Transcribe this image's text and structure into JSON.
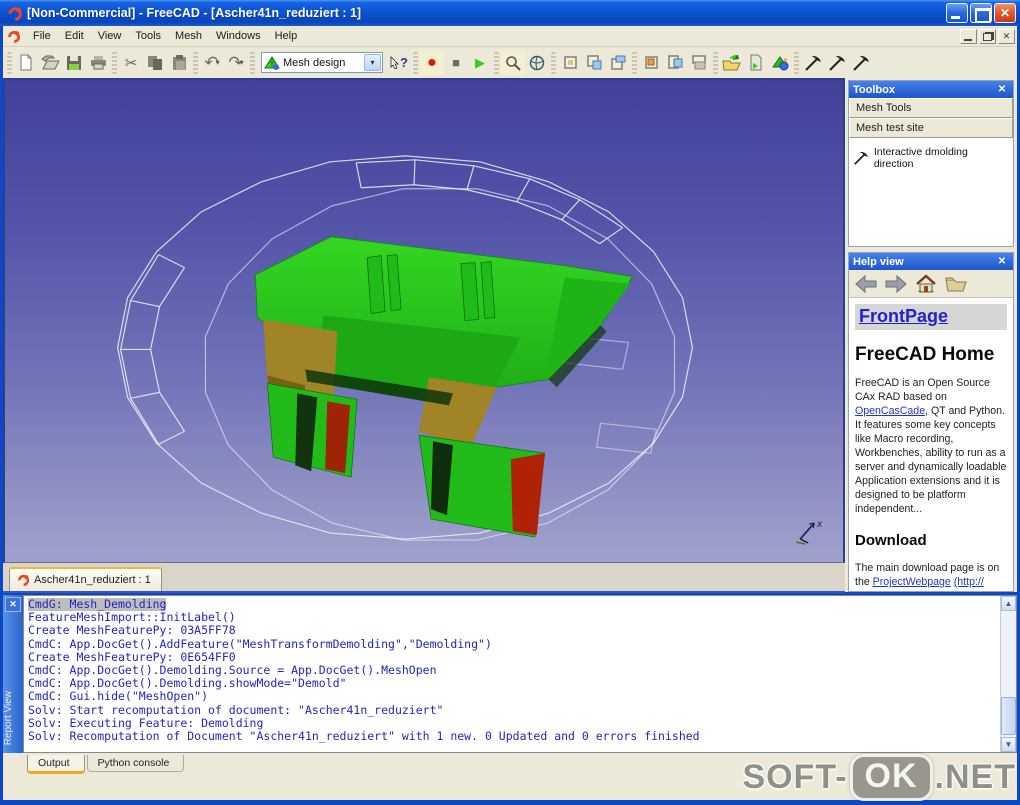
{
  "window": {
    "title": "[Non-Commercial] - FreeCAD - [Ascher41n_reduziert : 1]",
    "document_tab": "Ascher41n_reduziert : 1"
  },
  "menu": {
    "items": [
      "File",
      "Edit",
      "View",
      "Tools",
      "Mesh",
      "Windows",
      "Help"
    ]
  },
  "toolbar": {
    "workbench": {
      "selected": "Mesh design"
    },
    "icon_names": [
      "new-document",
      "open-document",
      "save",
      "print",
      "cut",
      "copy",
      "paste",
      "undo",
      "redo",
      "workbench-selector",
      "whats-this",
      "macro-record",
      "macro-stop",
      "macro-play",
      "zoom",
      "view-axonometric",
      "view-fit",
      "view-front",
      "view-top",
      "view-right",
      "view-rear",
      "view-bottom",
      "open-mesh",
      "export-mesh",
      "mesh-texture",
      "demolding-direction-1",
      "demolding-direction-2",
      "demolding-direction-3"
    ],
    "glyphs": {
      "undo": "↶",
      "redo": "↷",
      "dropdown": "▾",
      "record": "●",
      "stop": "■",
      "play": "▶",
      "question": "?"
    }
  },
  "viewport": {
    "axis_label": "x",
    "colors": {
      "bg_top": "#41419b",
      "bg_bottom": "#a0a1cd",
      "mesh_green": "#27c31c",
      "mesh_dark": "#0e350b",
      "patch_olive": "#a08426",
      "patch_red": "#b02206",
      "wireframe": "#eef0fa"
    }
  },
  "toolbox_panel": {
    "title": "Toolbox",
    "close_glyph": "✕",
    "groups": [
      {
        "label": "Mesh Tools"
      },
      {
        "label": "Mesh test site"
      }
    ],
    "items": [
      {
        "label": "Interactive dmolding direction"
      }
    ]
  },
  "help_panel": {
    "title": "Help view",
    "close_glyph": "✕",
    "front_link": "FrontPage",
    "heading": "FreeCAD Home",
    "body": {
      "t1": "FreeCAD is an Open Source CAx RAD based on ",
      "link1": "OpenCasCade",
      "t2": ", QT and Python. It features some key concepts like Macro recording, Workbenches, ability to run as a server and dynamically loadable Application extensions and it is designed to be platform independent..."
    },
    "download_heading": "Download",
    "download": {
      "t1": "The main download page is on the ",
      "link1": "ProjectWebpage",
      "t2": " ",
      "link2": "(http://"
    }
  },
  "report_view": {
    "label": "Report View",
    "close_glyph": "✕",
    "lines": [
      "CmdG: Mesh_Demolding",
      "FeatureMeshImport::InitLabel()",
      "Create MeshFeaturePy: 03A5FF78",
      "CmdC: App.DocGet().AddFeature(\"MeshTransformDemolding\",\"Demolding\")",
      "Create MeshFeaturePy: 0E654FF0",
      "CmdC: App.DocGet().Demolding.Source = App.DocGet().MeshOpen",
      "CmdC: App.DocGet().Demolding.showMode=\"Demold\"",
      "CmdC: Gui.hide(\"MeshOpen\")",
      "Solv: Start recomputation of document: \"Ascher41n_reduziert\"",
      "Solv: Executing Feature: Demolding",
      "Solv: Recomputation of Document \"Ascher41n_reduziert\" with 1 new. 0 Updated and 0 errors finished"
    ],
    "tabs": [
      {
        "label": "Output"
      },
      {
        "label": "Python console"
      }
    ]
  },
  "watermark": {
    "pre": "SOFT-",
    "badge": "OK",
    "post": ".NET"
  }
}
